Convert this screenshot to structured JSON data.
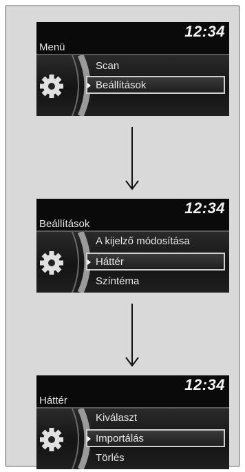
{
  "screens": [
    {
      "time": "12:34",
      "title": "Menü",
      "items": [
        "",
        "Scan",
        "Beállítások"
      ]
    },
    {
      "time": "12:34",
      "title": "Beállítások",
      "items": [
        "A kijelző módosítása",
        "Háttér",
        "Színtéma"
      ]
    },
    {
      "time": "12:34",
      "title": "Háttér",
      "items": [
        "Kiválaszt",
        "Importálás",
        "Törlés"
      ]
    }
  ],
  "colors": {
    "screen_bg": "#0a0a0a",
    "frame_bg": "#d9d9d9",
    "highlight_border": "#cfcfcf",
    "text": "#e8e8e8"
  },
  "icons": {
    "menu": "gear-icon",
    "flow": "arrow-down-icon",
    "selection": "selection-pointer-icon"
  },
  "selected_index": 2
}
